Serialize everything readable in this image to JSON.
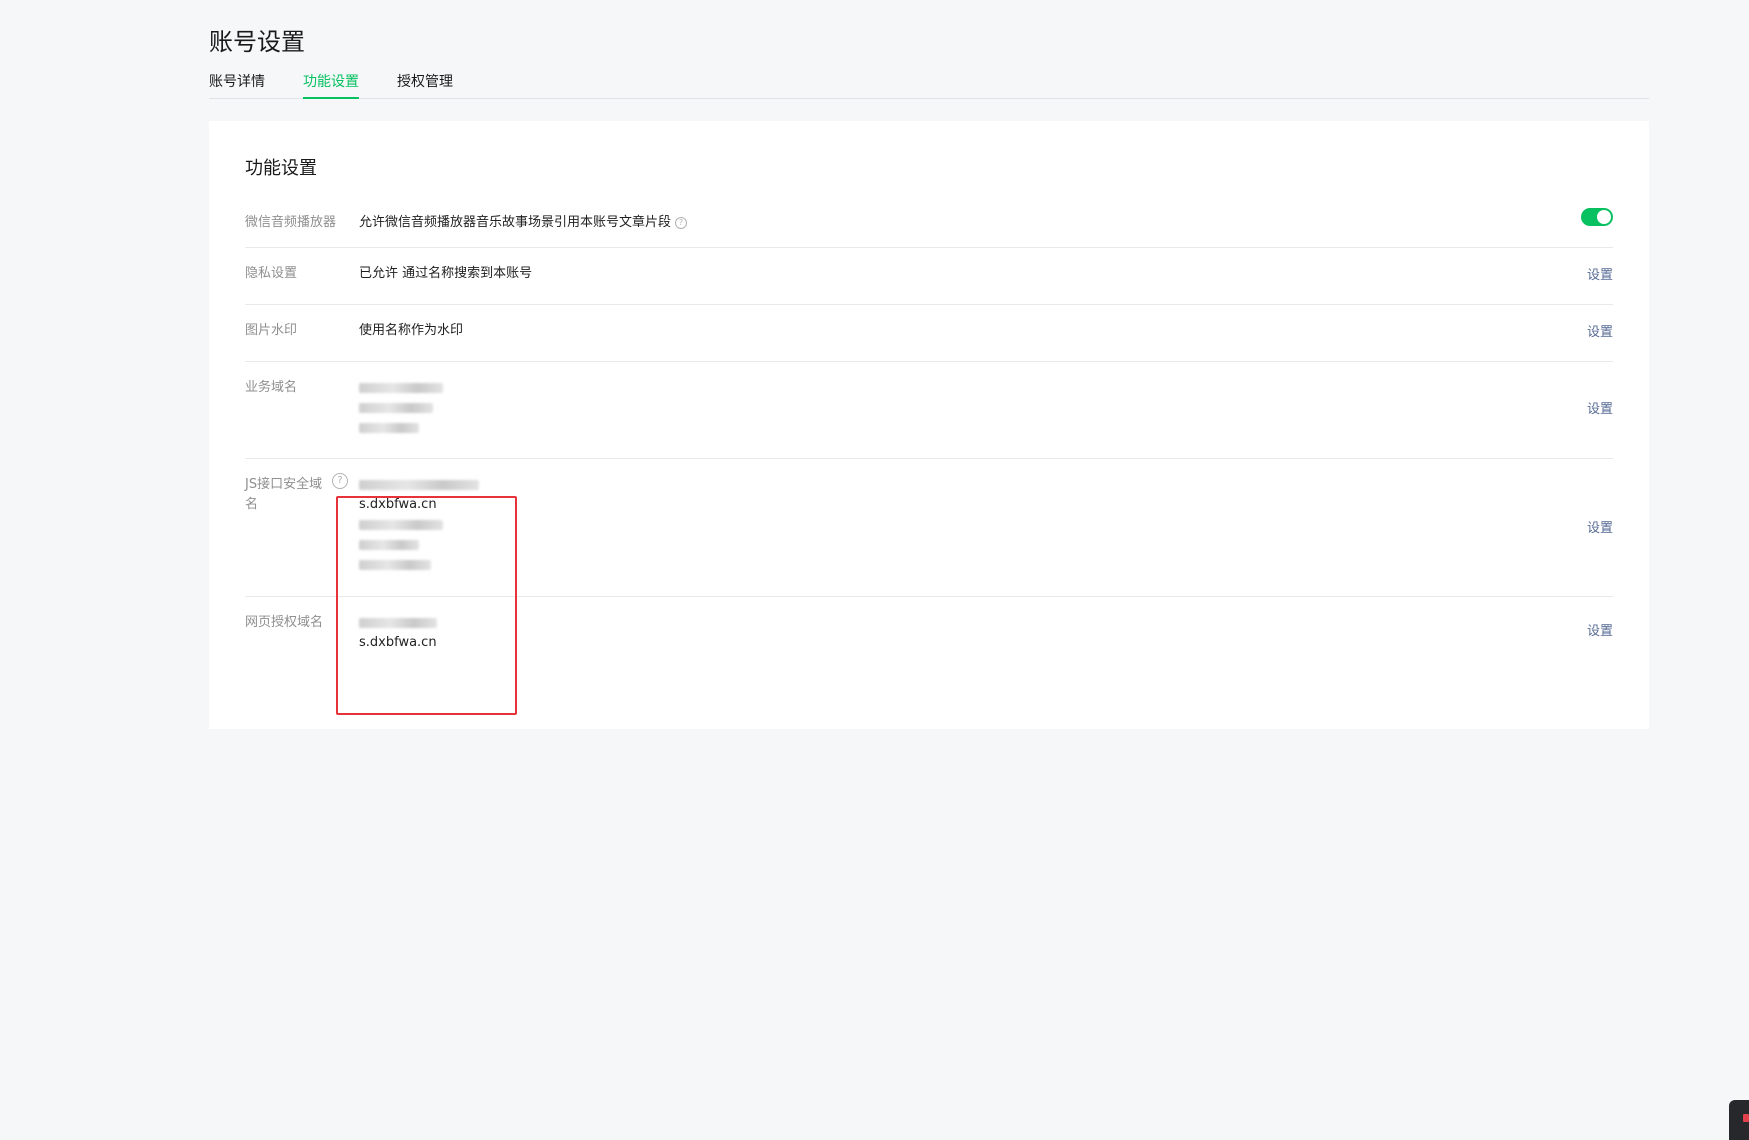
{
  "page": {
    "title": "账号设置"
  },
  "tabs": [
    {
      "label": "账号详情",
      "active": false
    },
    {
      "label": "功能设置",
      "active": true
    },
    {
      "label": "授权管理",
      "active": false
    }
  ],
  "section": {
    "title": "功能设置"
  },
  "rows": {
    "audio": {
      "label": "微信音频播放器",
      "value": "允许微信音频播放器音乐故事场景引用本账号文章片段",
      "toggle_on": true
    },
    "privacy": {
      "label": "隐私设置",
      "value": "已允许 通过名称搜索到本账号",
      "action": "设置"
    },
    "watermark": {
      "label": "图片水印",
      "value": "使用名称作为水印",
      "action": "设置"
    },
    "business_domain": {
      "label": "业务域名",
      "action": "设置"
    },
    "js_domain": {
      "label": "JS接口安全域名",
      "visible_domain": "s.dxbfwa.cn",
      "action": "设置"
    },
    "oauth_domain": {
      "label": "网页授权域名",
      "visible_domain": "s.dxbfwa.cn",
      "action": "设置"
    }
  },
  "colors": {
    "accent": "#07c160",
    "link": "#576b95",
    "highlight_box": "#e8323a"
  }
}
